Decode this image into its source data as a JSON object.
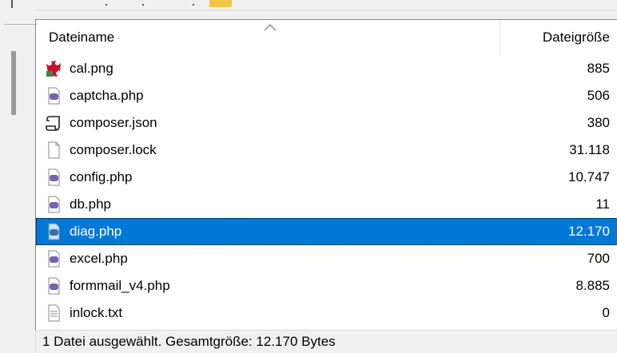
{
  "file_list": {
    "column_name": "Dateiname",
    "column_size": "Dateigröße",
    "rows": [
      {
        "name": "cal.png",
        "size": "885",
        "icon": "png-image-icon",
        "selected": false
      },
      {
        "name": "captcha.php",
        "size": "506",
        "icon": "php-file-icon",
        "selected": false
      },
      {
        "name": "composer.json",
        "size": "380",
        "icon": "json-script-icon",
        "selected": false
      },
      {
        "name": "composer.lock",
        "size": "31.118",
        "icon": "blank-file-icon",
        "selected": false
      },
      {
        "name": "config.php",
        "size": "10.747",
        "icon": "php-file-icon",
        "selected": false
      },
      {
        "name": "db.php",
        "size": "11",
        "icon": "php-file-icon",
        "selected": false
      },
      {
        "name": "diag.php",
        "size": "12.170",
        "icon": "php-file-icon",
        "selected": true
      },
      {
        "name": "excel.php",
        "size": "700",
        "icon": "php-file-icon",
        "selected": false
      },
      {
        "name": "formmail_v4.php",
        "size": "8.885",
        "icon": "php-file-icon",
        "selected": false
      },
      {
        "name": "inlock.txt",
        "size": "0",
        "icon": "text-file-icon",
        "selected": false
      }
    ]
  },
  "status_bar": {
    "text": "1 Datei ausgewählt. Gesamtgröße: 12.170 Bytes"
  },
  "colors": {
    "selection": "#0078d7",
    "php_icon": "#7b5fb2",
    "png_icon": "#c8102e"
  }
}
